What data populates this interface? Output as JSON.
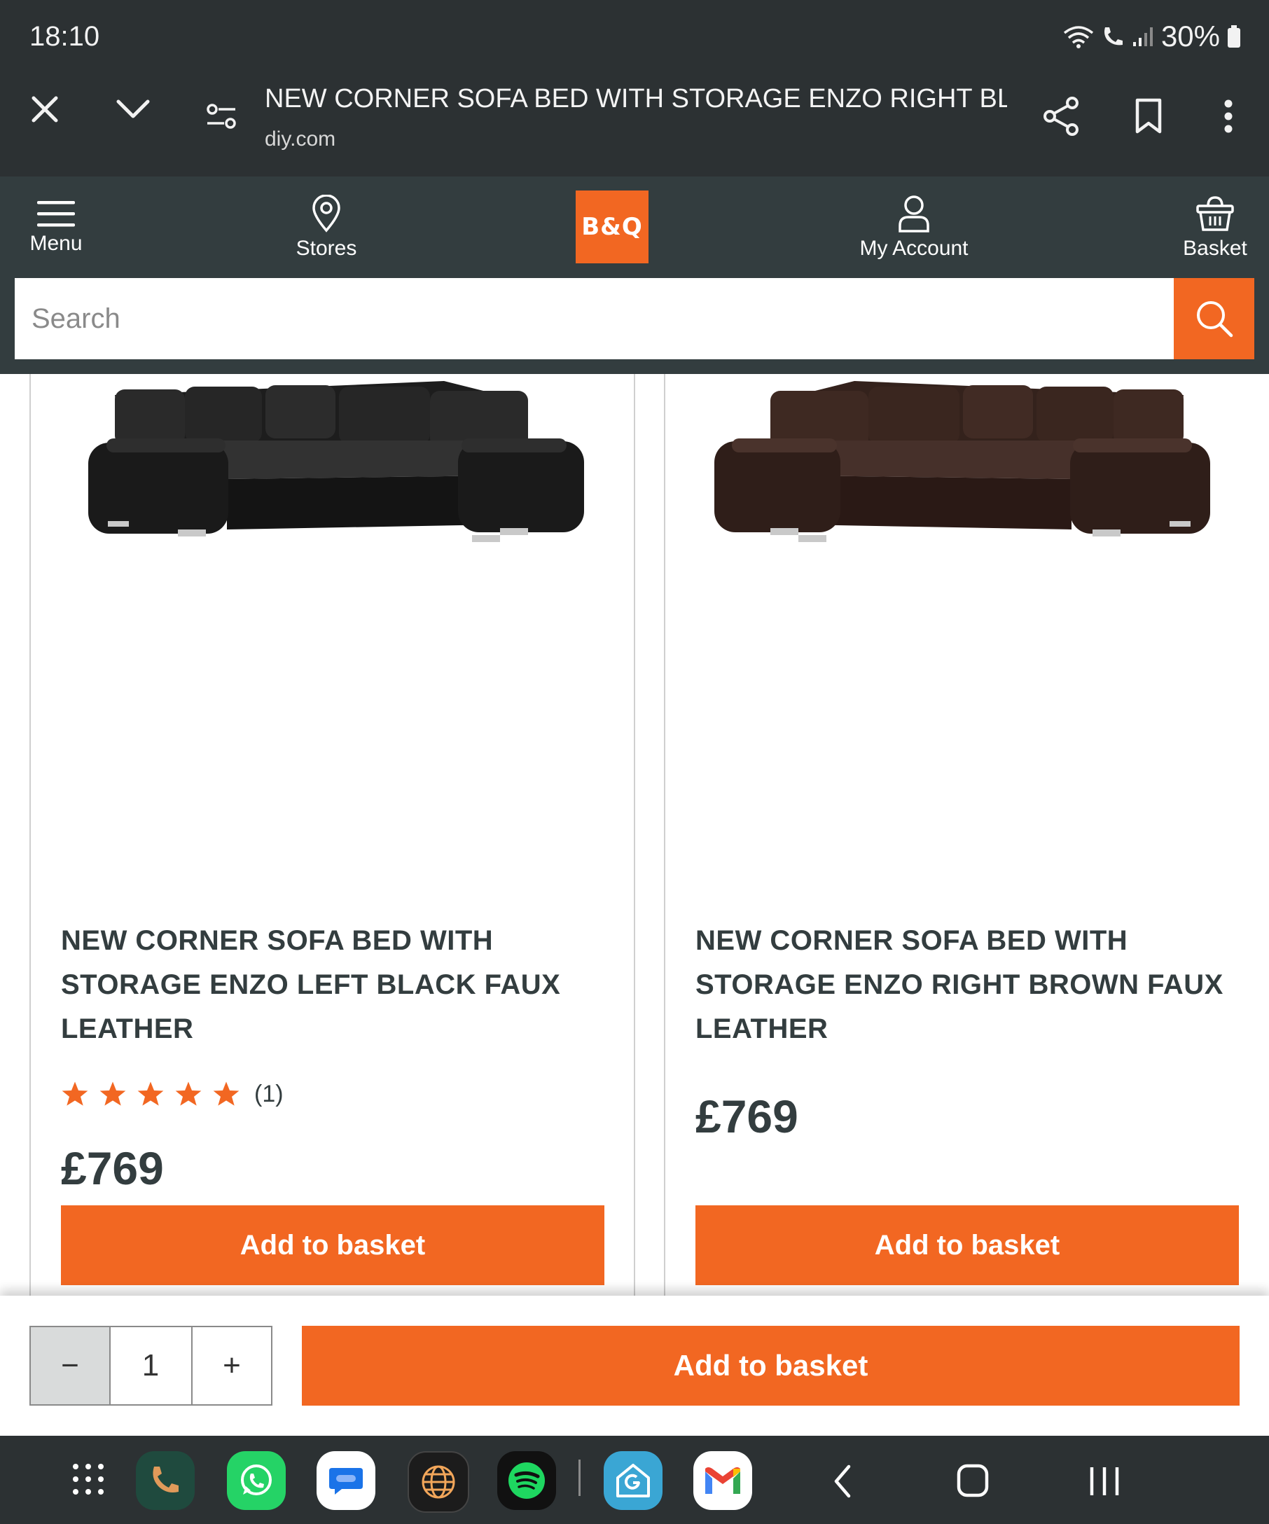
{
  "status_bar": {
    "time": "18:10",
    "battery": "30%"
  },
  "browser": {
    "page_title": "NEW CORNER SOFA BED WITH STORAGE ENZO RIGHT BLA...",
    "domain": "diy.com"
  },
  "header": {
    "menu_label": "Menu",
    "stores_label": "Stores",
    "logo_text": "B&Q",
    "account_label": "My Account",
    "basket_label": "Basket"
  },
  "search": {
    "placeholder": "Search"
  },
  "products": [
    {
      "title_lines": [
        "NEW CORNER SOFA BED WITH",
        "STORAGE ENZO LEFT BLACK FAUX",
        "LEATHER"
      ],
      "rating": 5,
      "rating_count": "(1)",
      "price": "£769",
      "button": "Add to basket",
      "color": "#1e1e1e"
    },
    {
      "title_lines": [
        "NEW CORNER SOFA BED WITH",
        "STORAGE ENZO RIGHT BROWN FAUX",
        "LEATHER"
      ],
      "price": "£769",
      "button": "Add to basket",
      "color": "#3b2620"
    }
  ],
  "sticky": {
    "minus": "−",
    "quantity": "1",
    "plus": "+",
    "button": "Add to basket"
  },
  "colors": {
    "accent": "#f26722",
    "header_bg": "#333d3f",
    "chrome_bg": "#2c3133"
  }
}
